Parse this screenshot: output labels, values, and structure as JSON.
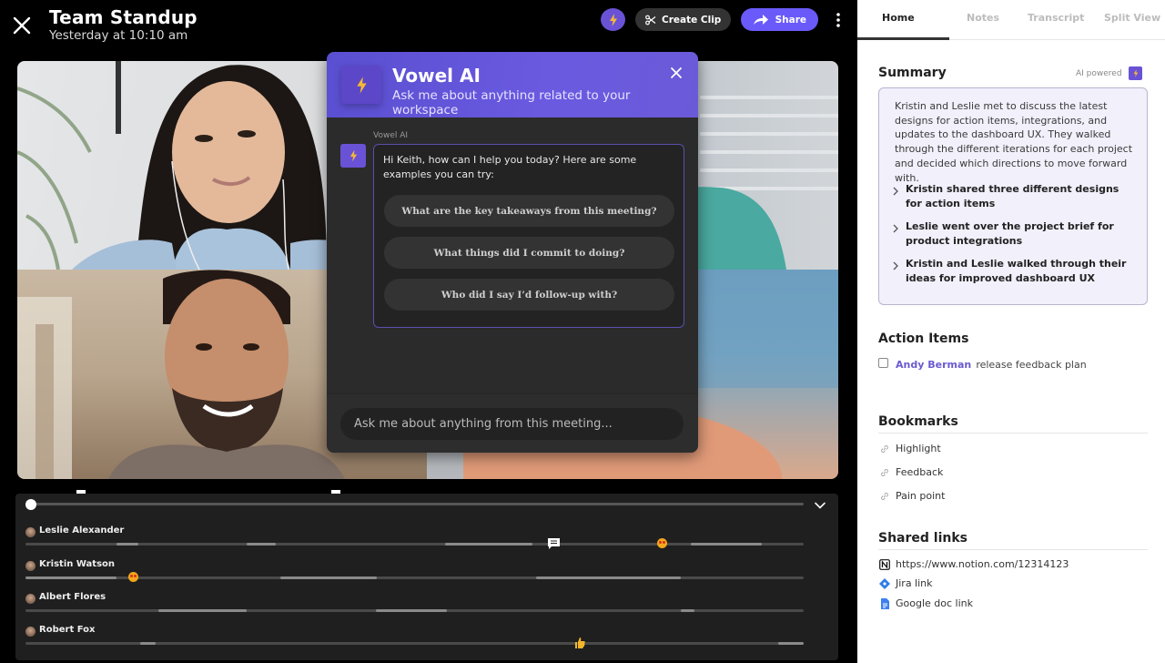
{
  "header": {
    "title": "Team Standup",
    "subtitle": "Yesterday at 10:10 am",
    "create_clip_label": "Create Clip",
    "share_label": "Share"
  },
  "colors": {
    "accent": "#6a5af9",
    "ai_purple": "#6a52d6",
    "ai_bolt": "#f5b935"
  },
  "ai_panel": {
    "title": "Vowel AI",
    "subtitle": "Ask me about anything related to your workspace",
    "sender": "Vowel AI",
    "message": "Hi Keith, how can I help you today? Here are some examples you can try:",
    "suggestions": [
      "What are the key takeaways from this meeting?",
      "What things did I commit to doing?",
      "Who did I say I’d follow-up with?"
    ],
    "input_placeholder": "Ask me about anything from this meeting..."
  },
  "timeline": {
    "playhead_position": 0,
    "bookmarks_at": [
      0.07,
      0.4
    ],
    "speakers": [
      {
        "name": "Leslie Alexander",
        "segments": [
          [
            0.117,
            0.145
          ],
          [
            0.284,
            0.322
          ],
          [
            0.539,
            0.651
          ],
          [
            0.855,
            0.946
          ]
        ],
        "markers": [
          {
            "type": "comment",
            "at": 0.678
          },
          {
            "type": "heart-eyes-emoji",
            "at": 0.817
          }
        ]
      },
      {
        "name": "Kristin Watson",
        "markers": [
          {
            "type": "heart-eyes-emoji",
            "at": 0.138
          }
        ],
        "segments": [
          [
            0.0,
            0.117
          ],
          [
            0.328,
            0.451
          ],
          [
            0.656,
            0.842
          ]
        ]
      },
      {
        "name": "Albert Flores",
        "segments": [
          [
            0.171,
            0.284
          ],
          [
            0.45,
            0.542
          ],
          [
            0.842,
            0.86
          ]
        ],
        "markers": []
      },
      {
        "name": "Robert Fox",
        "segments": [
          [
            0.147,
            0.167
          ],
          [
            0.967,
            1.0
          ]
        ],
        "markers": [
          {
            "type": "thumbs-up-emoji",
            "at": 0.712
          }
        ]
      }
    ]
  },
  "right_panel": {
    "tabs": [
      {
        "label": "Home",
        "active": true
      },
      {
        "label": "Notes",
        "active": false
      },
      {
        "label": "Transcript",
        "active": false
      },
      {
        "label": "Split View",
        "active": false
      }
    ],
    "summary": {
      "title": "Summary",
      "ai_label": "AI powered",
      "text": "Kristin and Leslie met to discuss the latest designs for action items, integrations, and updates to the dashboard UX. They walked through the different iterations for each project and decided which directions to move forward with.",
      "bullets": [
        "Kristin shared three different designs for action items",
        "Leslie went over the project brief for product integrations",
        "Kristin and Leslie walked through their ideas for improved dashboard UX"
      ]
    },
    "action_items": {
      "title": "Action Items",
      "items": [
        {
          "assignee": "Andy Berman",
          "task": "release feedback plan",
          "done": false
        }
      ]
    },
    "bookmarks": {
      "title": "Bookmarks",
      "items": [
        "Highlight",
        "Feedback",
        "Pain point"
      ]
    },
    "shared_links": {
      "title": "Shared links",
      "items": [
        {
          "icon": "notion-icon",
          "label": "https://www.notion.com/12314123"
        },
        {
          "icon": "jira-icon",
          "label": "Jira link"
        },
        {
          "icon": "google-doc-icon",
          "label": "Google doc link"
        }
      ]
    }
  }
}
